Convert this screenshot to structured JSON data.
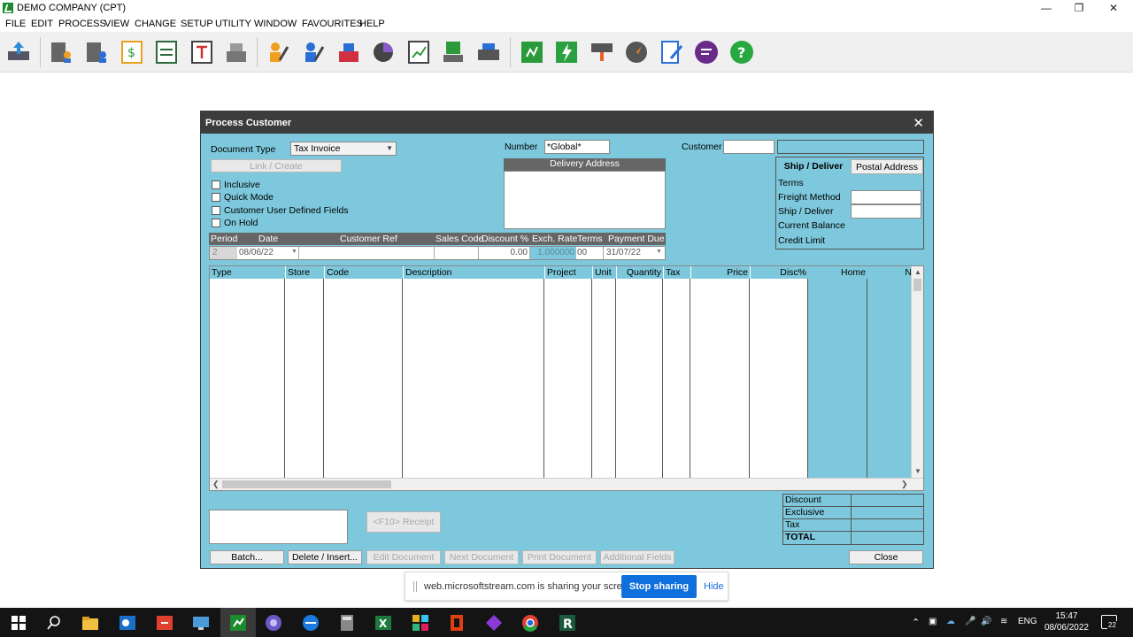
{
  "window": {
    "title": "DEMO COMPANY (CPT)"
  },
  "menu": [
    "FILE",
    "EDIT",
    "PROCESS",
    "VIEW",
    "CHANGE",
    "SETUP",
    "UTILITY",
    "WINDOW",
    "FAVOURITES",
    "HELP"
  ],
  "dialog": {
    "title": "Process Customer",
    "document_type_label": "Document Type",
    "document_type_value": "Tax Invoice",
    "link_create": "Link / Create",
    "checkboxes": [
      "Inclusive",
      "Quick Mode",
      "Customer User Defined Fields",
      "On Hold"
    ],
    "number_label": "Number",
    "number_value": "*Global*",
    "delivery_address_label": "Delivery Address",
    "customer_label": "Customer",
    "tabs": [
      "Ship / Deliver",
      "Postal Address"
    ],
    "ship_fields": [
      "Terms",
      "Freight Method",
      "Ship / Deliver",
      "Current Balance",
      "Credit Limit"
    ],
    "header_cols": [
      "Period",
      "Date",
      "Customer Ref",
      "Sales Code",
      "Discount %",
      "Exch. Rate",
      "Terms",
      "Payment Due"
    ],
    "header_values": {
      "period": "2",
      "date": "08/06/22",
      "discount": "0.00",
      "exch_rate": "1.000000",
      "terms": "00",
      "payment_due": "31/07/22"
    },
    "grid_cols": [
      "Type",
      "Store",
      "Code",
      "Description",
      "Project",
      "Unit",
      "Quantity",
      "Tax",
      "Price",
      "Disc%",
      "Home",
      "N"
    ],
    "f10_receipt": "<F10> Receipt",
    "totals": [
      "Discount",
      "Exclusive",
      "Tax",
      "TOTAL"
    ],
    "buttons": {
      "batch": "Batch...",
      "delete_insert": "Delete / Insert...",
      "edit_document": "Edit Document",
      "next_document": "Next Document",
      "print_document": "Print Document",
      "additional_fields": "Additional Fields",
      "close": "Close"
    }
  },
  "share_bar": {
    "text": "web.microsoftstream.com is sharing your screen.",
    "stop": "Stop sharing",
    "hide": "Hide"
  },
  "taskbar": {
    "lang": "ENG",
    "time": "15:47",
    "date": "08/06/2022",
    "notif_count": "22"
  },
  "colors": {
    "dialog_bg": "#7dc8dc",
    "title_bg": "#3c3c3c",
    "accent_blue": "#0f6fdc"
  }
}
